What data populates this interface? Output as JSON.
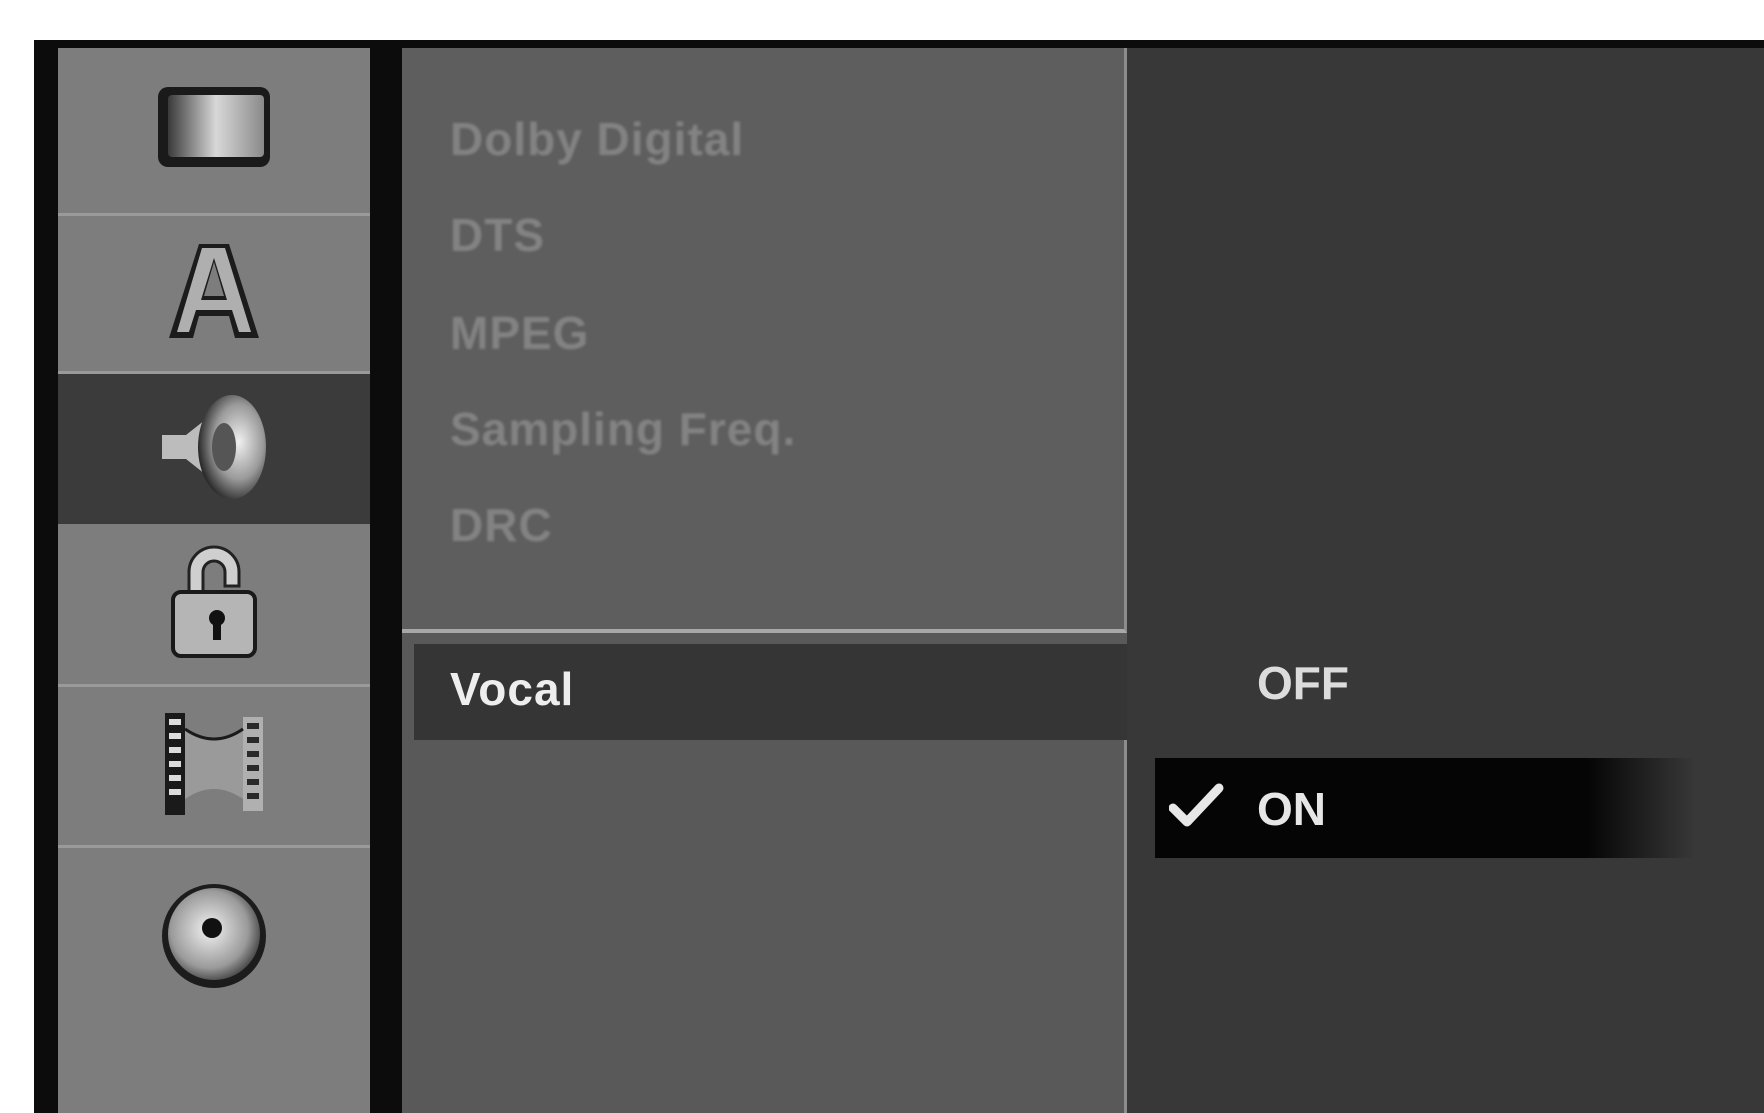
{
  "sidebar": {
    "items": [
      {
        "icon": "tv-screen-icon",
        "selected": false
      },
      {
        "icon": "language-a-icon",
        "selected": false
      },
      {
        "icon": "speaker-icon",
        "selected": true
      },
      {
        "icon": "padlock-icon",
        "selected": false
      },
      {
        "icon": "film-reel-icon",
        "selected": false
      },
      {
        "icon": "disc-icon",
        "selected": false
      }
    ]
  },
  "menu": {
    "items": [
      {
        "label": "Dolby Digital",
        "enabled": false
      },
      {
        "label": "DTS",
        "enabled": false
      },
      {
        "label": "MPEG",
        "enabled": false
      },
      {
        "label": "Sampling Freq.",
        "enabled": false
      },
      {
        "label": "DRC",
        "enabled": false
      }
    ],
    "selected_item": {
      "label": "Vocal"
    }
  },
  "options": {
    "off_label": "OFF",
    "on_label": "ON",
    "checked": "ON"
  },
  "colors": {
    "sidebar_bg": "#7d7d7d",
    "selected_bg": "#3b3b3b",
    "menu_bg": "#5e5e5e",
    "options_bg": "#383838",
    "highlight_bg": "#050505"
  }
}
